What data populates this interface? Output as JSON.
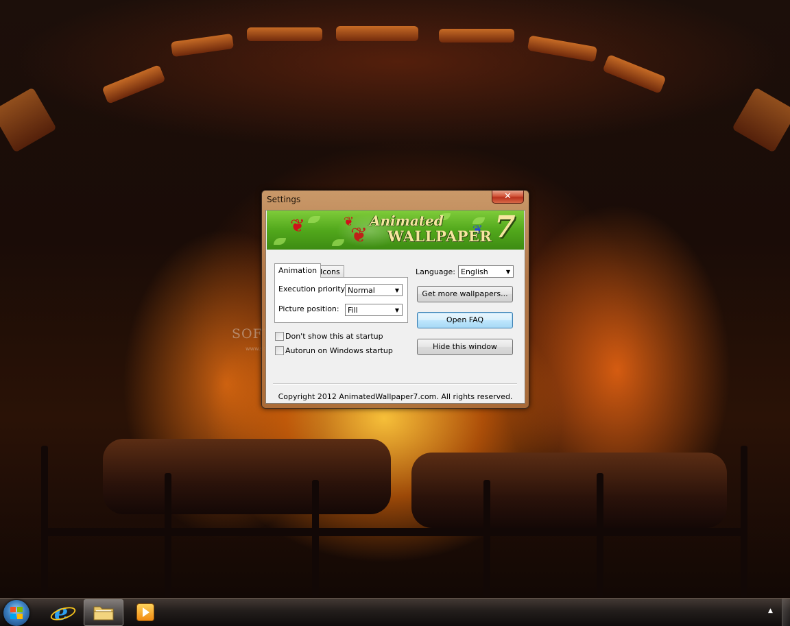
{
  "dialog": {
    "title": "Settings",
    "close_glyph": "✕",
    "banner": {
      "line1": "Animated",
      "line2": "WALLPAPER",
      "number": "7"
    },
    "tabs": [
      {
        "label": "Animation",
        "active": true
      },
      {
        "label": "Icons",
        "active": false
      }
    ],
    "animation_tab": {
      "execution_priority_label": "Execution priority:",
      "execution_priority_value": "Normal",
      "picture_position_label": "Picture position:",
      "picture_position_value": "Fill"
    },
    "checkboxes": [
      {
        "label": "Don't show this at startup",
        "checked": false
      },
      {
        "label": "Autorun on Windows startup",
        "checked": false
      }
    ],
    "language_label": "Language:",
    "language_value": "English",
    "buttons": {
      "get_more": "Get more wallpapers...",
      "open_faq": "Open FAQ",
      "hide": "Hide this window"
    },
    "copyright": "Copyright 2012 AnimatedWallpaper7.com. All rights reserved."
  },
  "watermark": {
    "text": "SOFTPEDIA",
    "url": "www.softpedia.com"
  },
  "taskbar": {
    "pinned": [
      "start-orb",
      "internet-explorer-icon",
      "windows-explorer-icon",
      "windows-media-player-icon"
    ],
    "tray_arrow": "▲"
  },
  "colors": {
    "banner_green": "#52a81c",
    "close_red": "#c8402a",
    "faq_button_blue": "#bee6fd"
  }
}
